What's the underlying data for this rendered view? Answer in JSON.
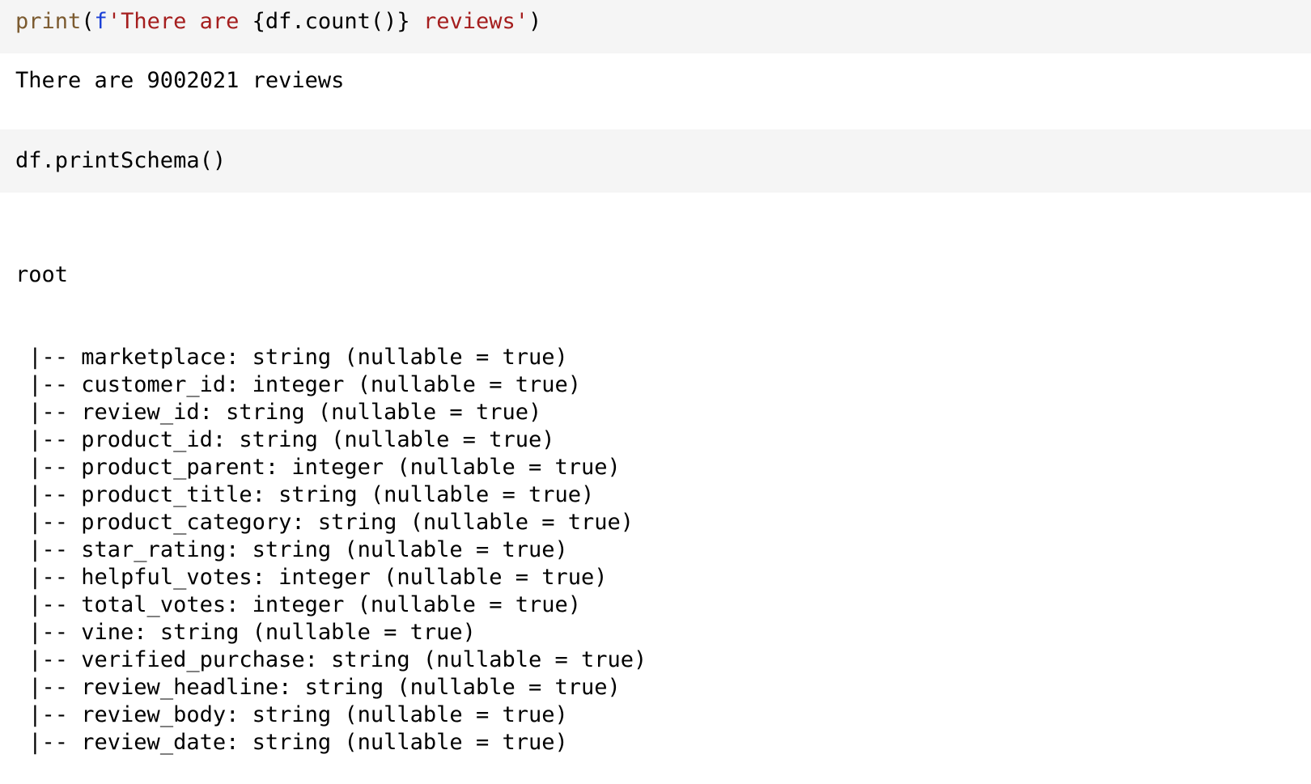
{
  "cells": [
    {
      "type": "code",
      "tokens": {
        "fn": "print",
        "open_paren": "(",
        "prefix": "f",
        "str_start": "'There are ",
        "expr": "{df.count()}",
        "str_end": " reviews'",
        "close_paren": ")"
      }
    },
    {
      "type": "output",
      "text": "There are 9002021 reviews"
    },
    {
      "type": "code",
      "text": "df.printSchema()"
    },
    {
      "type": "output",
      "root_label": "root",
      "tree_prefix": " |-- ",
      "fields": [
        "marketplace: string (nullable = true)",
        "customer_id: integer (nullable = true)",
        "review_id: string (nullable = true)",
        "product_id: string (nullable = true)",
        "product_parent: integer (nullable = true)",
        "product_title: string (nullable = true)",
        "product_category: string (nullable = true)",
        "star_rating: string (nullable = true)",
        "helpful_votes: integer (nullable = true)",
        "total_votes: integer (nullable = true)",
        "vine: string (nullable = true)",
        "verified_purchase: string (nullable = true)",
        "review_headline: string (nullable = true)",
        "review_body: string (nullable = true)",
        "review_date: string (nullable = true)"
      ]
    }
  ],
  "colors": {
    "code_bg": "#f5f5f5",
    "builtin": "#7b5a2f",
    "string": "#a51e1e",
    "prefix": "#1a3fd6"
  }
}
